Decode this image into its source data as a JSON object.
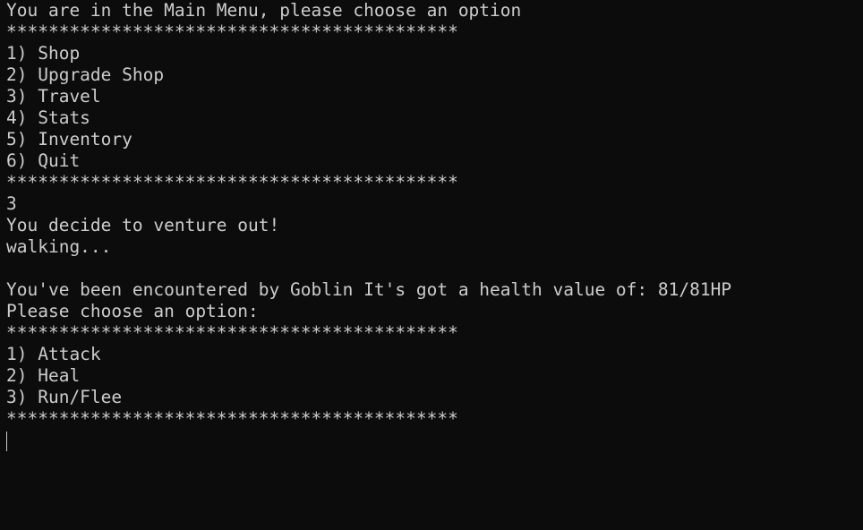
{
  "terminal": {
    "colors": {
      "background": "#0c0c0c",
      "foreground": "#cccccc"
    },
    "main_menu": {
      "prompt": "You are in the Main Menu, please choose an option",
      "separator_top": "*******************************************",
      "options": [
        "1) Shop",
        "2) Upgrade Shop",
        "3) Travel",
        "4) Stats",
        "5) Inventory",
        "6) Quit"
      ],
      "separator_bottom": "*******************************************"
    },
    "user_input": "3",
    "travel": {
      "message": "You decide to venture out!",
      "status": "walking..."
    },
    "encounter": {
      "message": "You've been encountered by Goblin It's got a health value of: 81/81HP",
      "prompt": "Please choose an option:",
      "separator_top": "*******************************************",
      "options": [
        "1) Attack",
        "2) Heal",
        "3) Run/Flee"
      ],
      "separator_bottom": "*******************************************"
    }
  }
}
